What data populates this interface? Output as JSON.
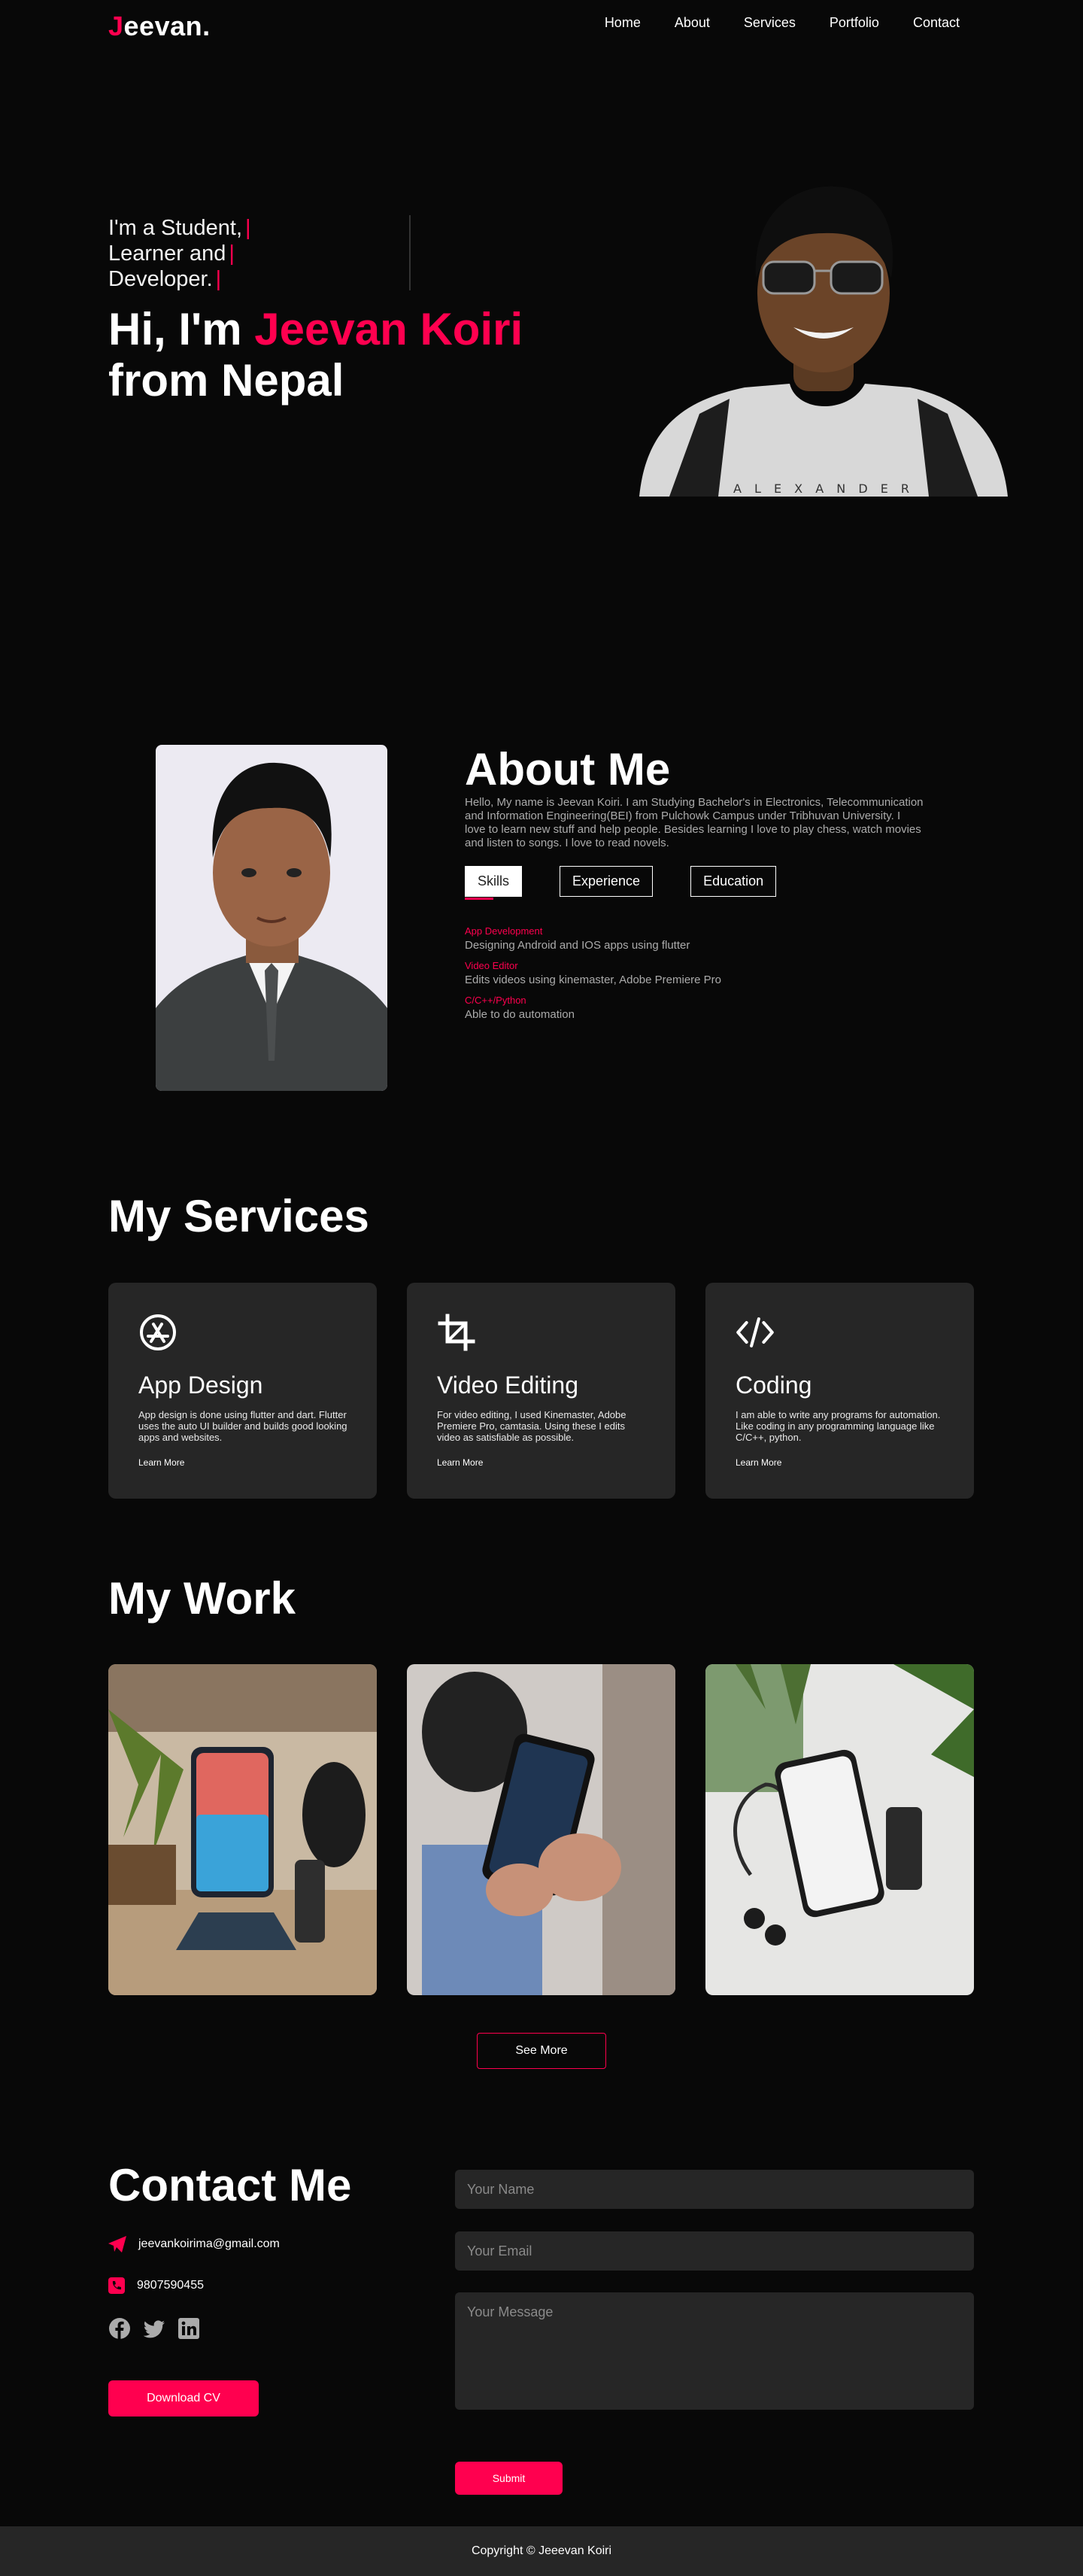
{
  "brand": {
    "logo_first": "J",
    "logo_rest": "eevan.",
    "accent": "#ff004f"
  },
  "nav": {
    "items": [
      "Home",
      "About",
      "Services",
      "Portfolio",
      "Contact"
    ]
  },
  "hero": {
    "lines": [
      "I'm a Student,",
      "Learner and",
      "Developer."
    ],
    "cursor": "|",
    "greet": "Hi, I'm ",
    "name": "Jeevan Koiri",
    "from": "from Nepal"
  },
  "about": {
    "title": "About Me",
    "text": "Hello, My name is Jeevan Koiri. I am Studying Bachelor's in Electronics, Telecommunication and Information Engineering(BEI) from Pulchowk Campus under Tribhuvan University. I love to learn new stuff and help people. Besides learning I love to play chess, watch movies and listen to songs. I love to read novels.",
    "tabs": [
      "Skills",
      "Experience",
      "Education"
    ],
    "skills": [
      {
        "title": "App Development",
        "desc": "Designing Android and IOS apps using flutter"
      },
      {
        "title": "Video Editor",
        "desc": "Edits videos using kinemaster, Adobe Premiere Pro"
      },
      {
        "title": "C/C++/Python",
        "desc": "Able to do automation"
      }
    ]
  },
  "services": {
    "title": "My Services",
    "items": [
      {
        "icon": "app-store-icon",
        "name": "App Design",
        "desc": "App design is done using flutter and dart. Flutter uses the auto UI builder and builds good looking apps and websites.",
        "link": "Learn More"
      },
      {
        "icon": "crop-icon",
        "name": "Video Editing",
        "desc": "For video editing, I used Kinemaster, Adobe Premiere Pro, camtasia. Using these I edits video as satisfiable as possible.",
        "link": "Learn More"
      },
      {
        "icon": "code-icon",
        "name": "Coding",
        "desc": "I am able to write any programs for automation. Like coding in any programming language like C/C++, python.",
        "link": "Learn More"
      }
    ]
  },
  "work": {
    "title": "My Work",
    "see_more": "See More"
  },
  "contact": {
    "title": "Contact Me",
    "email": "jeevankoirima@gmail.com",
    "phone": "9807590455",
    "download": "Download CV",
    "name_placeholder": "Your Name",
    "email_placeholder": "Your Email",
    "message_placeholder": "Your Message",
    "submit": "Submit"
  },
  "footer": {
    "copyright": "Copyright © Jeeevan Koiri"
  }
}
